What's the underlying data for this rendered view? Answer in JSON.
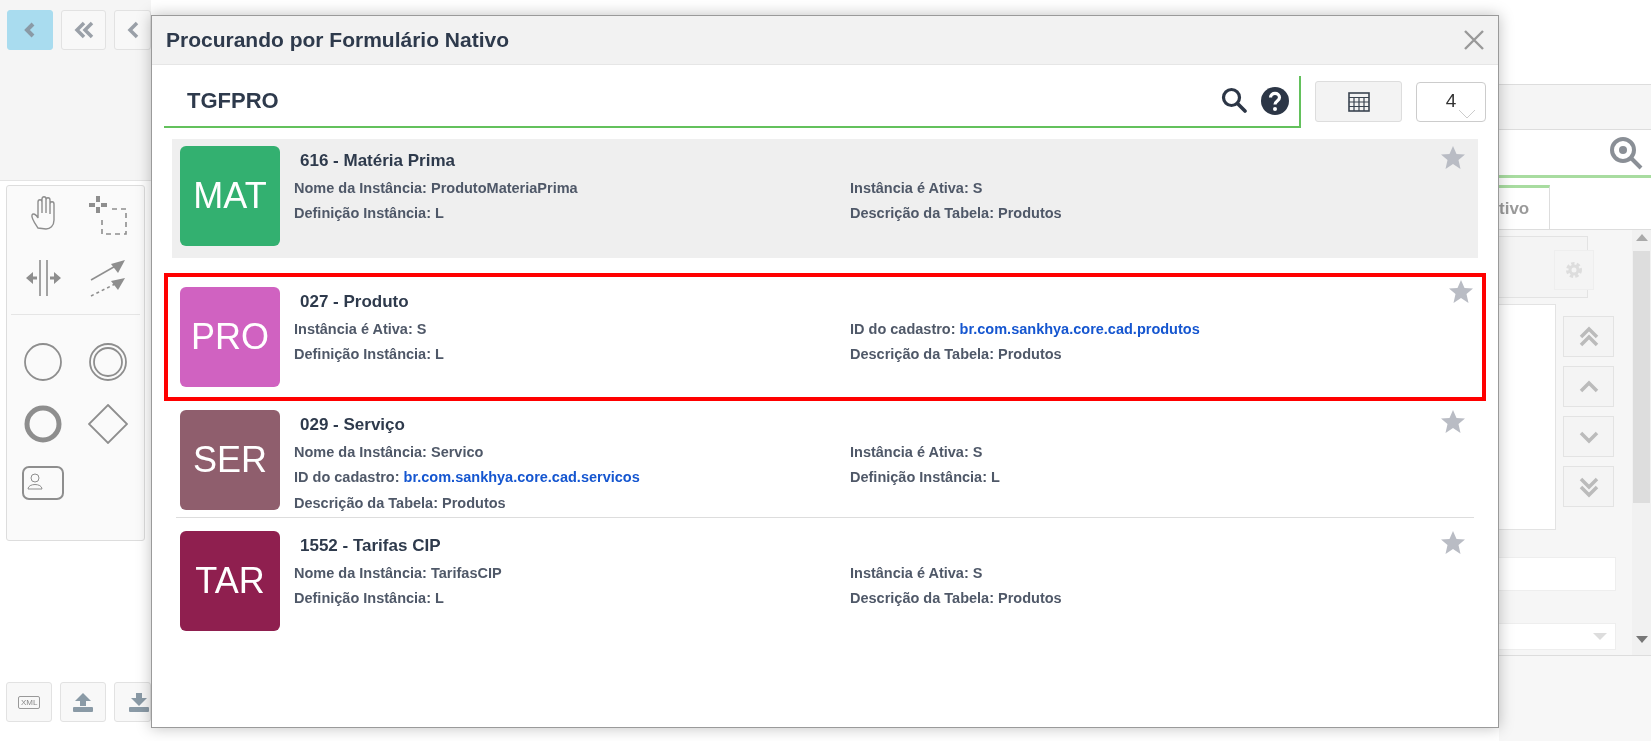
{
  "background": {
    "nav_buttons": [
      {
        "selected": true
      },
      {
        "selected": false
      },
      {
        "selected": false
      }
    ],
    "bottom_buttons": [
      {
        "kind": "xml",
        "label": "XML"
      },
      {
        "kind": "upload"
      },
      {
        "kind": "download"
      }
    ],
    "side_tab": "tivo"
  },
  "dialog": {
    "title": "Procurando por Formulário Nativo",
    "search": {
      "value": "TGFPRO"
    },
    "count": "4",
    "results": [
      {
        "badge": "MAT",
        "color": "#33b070",
        "title": "616 - Matéria Prima",
        "selected": true,
        "highlighted": false,
        "favorite": false,
        "fields": [
          {
            "label": "Nome da Instância:",
            "value": "ProdutoMateriaPrima",
            "kind": "text"
          },
          {
            "label": "Instância é Ativa:",
            "value": "S",
            "kind": "text"
          },
          {
            "label": "Definição Instância:",
            "value": "L",
            "kind": "text"
          },
          {
            "label": "Descrição da Tabela:",
            "value": "Produtos",
            "kind": "text"
          }
        ]
      },
      {
        "badge": "PRO",
        "color": "#d062c1",
        "title": "027 - Produto",
        "selected": false,
        "highlighted": true,
        "favorite": false,
        "fields": [
          {
            "label": "Instância é Ativa:",
            "value": "S",
            "kind": "text"
          },
          {
            "label": "ID do cadastro:",
            "value": "br.com.sankhya.core.cad.produtos",
            "kind": "link"
          },
          {
            "label": "Definição Instância:",
            "value": "L",
            "kind": "text"
          },
          {
            "label": "Descrição da Tabela:",
            "value": "Produtos",
            "kind": "text"
          }
        ]
      },
      {
        "badge": "SER",
        "color": "#8f5e6d",
        "title": "029 - Serviço",
        "selected": false,
        "highlighted": false,
        "favorite": false,
        "fields": [
          {
            "label": "Nome da Instância:",
            "value": "Servico",
            "kind": "text"
          },
          {
            "label": "Instância é Ativa:",
            "value": "S",
            "kind": "text"
          },
          {
            "label": "ID do cadastro:",
            "value": "br.com.sankhya.core.cad.servicos",
            "kind": "link"
          },
          {
            "label": "Definição Instância:",
            "value": "L",
            "kind": "text"
          },
          {
            "label": "Descrição da Tabela:",
            "value": "Produtos",
            "kind": "text"
          }
        ]
      },
      {
        "badge": "TAR",
        "color": "#8f1f4f",
        "title": "1552 - Tarifas CIP",
        "selected": false,
        "highlighted": false,
        "favorite": false,
        "fields": [
          {
            "label": "Nome da Instância:",
            "value": "TarifasCIP",
            "kind": "text"
          },
          {
            "label": "Instância é Ativa:",
            "value": "S",
            "kind": "text"
          },
          {
            "label": "Definição Instância:",
            "value": "L",
            "kind": "text"
          },
          {
            "label": "Descrição da Tabela:",
            "value": "Produtos",
            "kind": "text"
          }
        ]
      }
    ]
  }
}
